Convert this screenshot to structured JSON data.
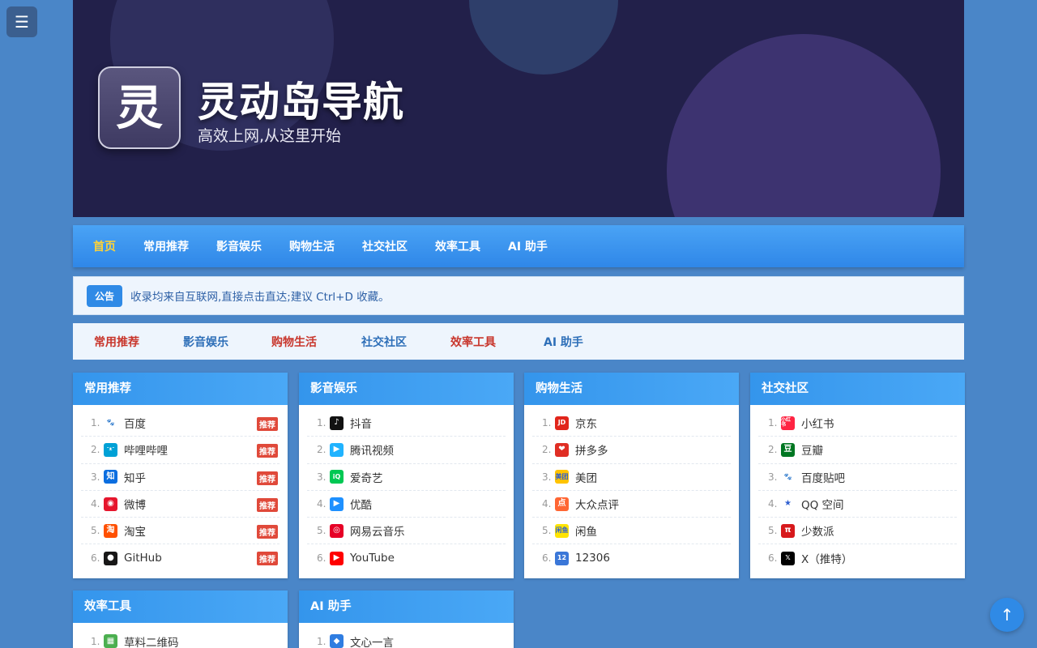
{
  "menu_icon": "☰",
  "hero": {
    "logo_char": "灵",
    "title": "灵动岛导航",
    "subtitle": "高效上网,从这里开始"
  },
  "mainnav": [
    "首页",
    "常用推荐",
    "影音娱乐",
    "购物生活",
    "社交社区",
    "效率工具",
    "AI 助手"
  ],
  "notice": {
    "badge": "公告",
    "text": "收录均来自互联网,直接点击直达;建议 Ctrl+D 收藏。"
  },
  "catnav": [
    "常用推荐",
    "影音娱乐",
    "购物生活",
    "社交社区",
    "效率工具",
    "AI 助手"
  ],
  "cards": [
    {
      "title": "常用推荐",
      "items": [
        {
          "num": "1.",
          "name": "百度",
          "icon": "baidu-icon",
          "glyph": "🐾",
          "color": "#ffffff",
          "tag": "推荐"
        },
        {
          "num": "2.",
          "name": "哔哩哔哩",
          "icon": "bilibili-icon",
          "glyph": "ᵔᴥᵔ",
          "color": "#00a1d6",
          "tag": "推荐"
        },
        {
          "num": "3.",
          "name": "知乎",
          "icon": "zhihu-icon",
          "glyph": "知",
          "color": "#0b6ee0",
          "tag": "推荐"
        },
        {
          "num": "4.",
          "name": "微博",
          "icon": "weibo-icon",
          "glyph": "◉",
          "color": "#e6162d",
          "tag": "推荐"
        },
        {
          "num": "5.",
          "name": "淘宝",
          "icon": "taobao-icon",
          "glyph": "淘",
          "color": "#ff5000",
          "tag": "推荐"
        },
        {
          "num": "6.",
          "name": "GitHub",
          "icon": "github-icon",
          "glyph": "●",
          "color": "#181717",
          "tag": "推荐"
        }
      ]
    },
    {
      "title": "影音娱乐",
      "items": [
        {
          "num": "1.",
          "name": "抖音",
          "icon": "douyin-icon",
          "glyph": "♪",
          "color": "#111111"
        },
        {
          "num": "2.",
          "name": "腾讯视频",
          "icon": "tencent-video-icon",
          "glyph": "▶",
          "color": "#20b3ff"
        },
        {
          "num": "3.",
          "name": "爱奇艺",
          "icon": "iqiyi-icon",
          "glyph": "iQ",
          "color": "#00c853"
        },
        {
          "num": "4.",
          "name": "优酷",
          "icon": "youku-icon",
          "glyph": "▶",
          "color": "#1e90ff"
        },
        {
          "num": "5.",
          "name": "网易云音乐",
          "icon": "netease-music-icon",
          "glyph": "◎",
          "color": "#e60026"
        },
        {
          "num": "6.",
          "name": "YouTube",
          "icon": "youtube-icon",
          "glyph": "▶",
          "color": "#ff0000"
        }
      ]
    },
    {
      "title": "购物生活",
      "items": [
        {
          "num": "1.",
          "name": "京东",
          "icon": "jd-icon",
          "glyph": "JD",
          "color": "#e1251b"
        },
        {
          "num": "2.",
          "name": "拼多多",
          "icon": "pinduoduo-icon",
          "glyph": "❤",
          "color": "#e02e24"
        },
        {
          "num": "3.",
          "name": "美团",
          "icon": "meituan-icon",
          "glyph": "美团",
          "color": "#ffc300"
        },
        {
          "num": "4.",
          "name": "大众点评",
          "icon": "dianping-icon",
          "glyph": "点",
          "color": "#ff6633"
        },
        {
          "num": "5.",
          "name": "闲鱼",
          "icon": "xianyu-icon",
          "glyph": "闲鱼",
          "color": "#ffe400"
        },
        {
          "num": "6.",
          "name": "12306",
          "icon": "12306-icon",
          "glyph": "12",
          "color": "#3b77d8"
        }
      ]
    },
    {
      "title": "社交社区",
      "items": [
        {
          "num": "1.",
          "name": "小红书",
          "icon": "xiaohongshu-icon",
          "glyph": "小红书",
          "color": "#ff2442"
        },
        {
          "num": "2.",
          "name": "豆瓣",
          "icon": "douban-icon",
          "glyph": "豆",
          "color": "#007722"
        },
        {
          "num": "3.",
          "name": "百度贴吧",
          "icon": "tieba-icon",
          "glyph": "🐾",
          "color": "#ffffff"
        },
        {
          "num": "4.",
          "name": "QQ 空间",
          "icon": "qzone-icon",
          "glyph": "★",
          "color": "#ffffff"
        },
        {
          "num": "5.",
          "name": "少数派",
          "icon": "sspai-icon",
          "glyph": "π",
          "color": "#d7191c"
        },
        {
          "num": "6.",
          "name": "X（推特）",
          "icon": "x-icon",
          "glyph": "𝕏",
          "color": "#000000"
        }
      ]
    },
    {
      "title": "效率工具",
      "items": [
        {
          "num": "1.",
          "name": "草料二维码",
          "icon": "caoliao-qrcode-icon",
          "glyph": "▦",
          "color": "#4caf50"
        }
      ]
    },
    {
      "title": "AI 助手",
      "items": [
        {
          "num": "1.",
          "name": "文心一言",
          "icon": "wenxin-icon",
          "glyph": "◆",
          "color": "#2f7de1"
        }
      ]
    }
  ],
  "back_top_icon": "↑"
}
